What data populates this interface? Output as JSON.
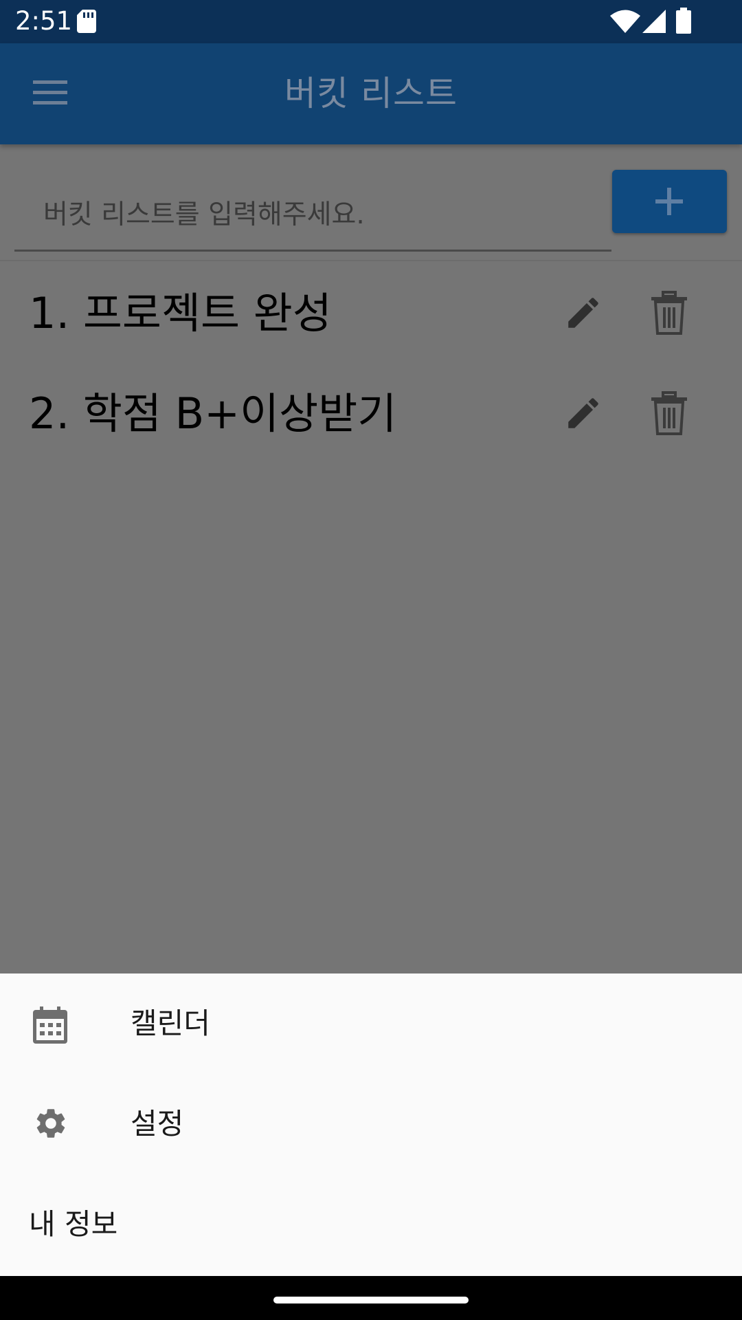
{
  "status_bar": {
    "time": "2:51",
    "icons": [
      "sd-card-icon",
      "wifi-icon",
      "signal-icon",
      "battery-icon"
    ]
  },
  "app_bar": {
    "title": "버킷 리스트",
    "menu_icon": "menu-icon",
    "background": "#114372"
  },
  "input": {
    "placeholder": "버킷 리스트를 입력해주세요.",
    "value": "",
    "add_icon": "plus-icon",
    "accent": "#0f4a80"
  },
  "list": {
    "items": [
      {
        "label": "1. 프로젝트 완성",
        "edit_icon": "pencil-icon",
        "delete_icon": "trash-icon"
      },
      {
        "label": "2. 학점 B+이상받기",
        "edit_icon": "pencil-icon",
        "delete_icon": "trash-icon"
      }
    ]
  },
  "bottom_sheet": {
    "items": [
      {
        "label": "캘린더",
        "icon": "calendar-icon"
      },
      {
        "label": "설정",
        "icon": "gear-icon"
      },
      {
        "label": "내 정보",
        "icon": null
      }
    ]
  }
}
